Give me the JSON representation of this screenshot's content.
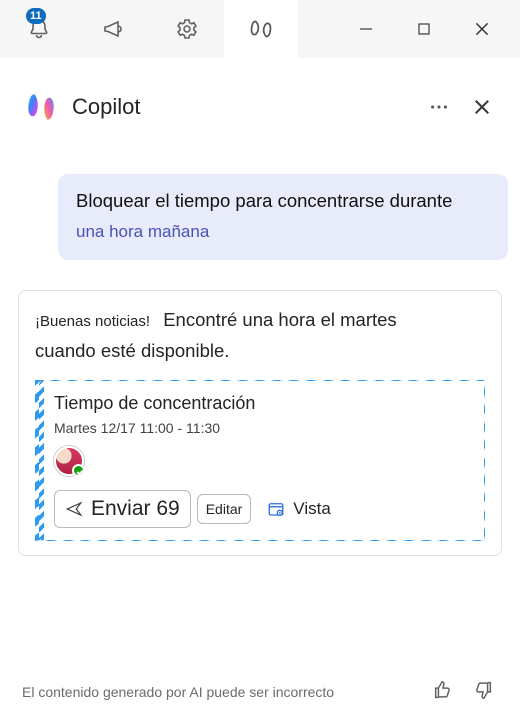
{
  "titlebar": {
    "notification_count": "11"
  },
  "pane": {
    "title": "Copilot"
  },
  "user_message": {
    "line1": "Bloquear el tiempo para concentrarse durante",
    "line2": "una hora mañana"
  },
  "assistant": {
    "good_news": "¡Buenas noticias!",
    "found_part1": "Encontré una hora el martes",
    "found_part2": "cuando esté disponible."
  },
  "event": {
    "title": "Tiempo de concentración",
    "time": "Martes 12/17 11:00 - 11:30",
    "send_label": "Enviar 69",
    "edit_label": "Editar",
    "view_label": "Vista"
  },
  "footer": {
    "disclaimer": "El contenido generado por AI puede ser incorrecto"
  }
}
